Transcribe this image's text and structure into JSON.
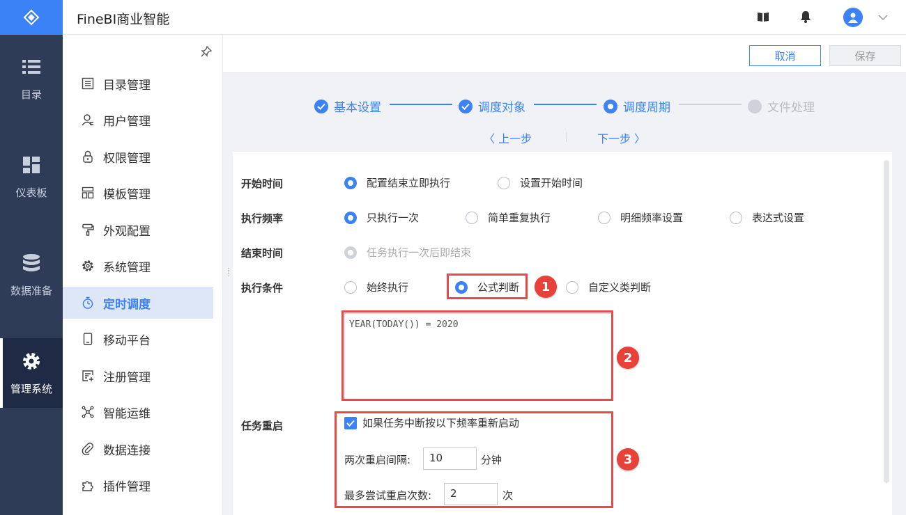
{
  "app": {
    "title": "FineBI商业智能"
  },
  "rail": [
    {
      "label": "目录",
      "icon": "list-icon"
    },
    {
      "label": "仪表板",
      "icon": "dashboard-icon"
    },
    {
      "label": "数据准备",
      "icon": "database-icon"
    },
    {
      "label": "管理系统",
      "icon": "gear-icon",
      "active": true
    }
  ],
  "menu": [
    {
      "label": "目录管理",
      "icon": "catalog-icon"
    },
    {
      "label": "用户管理",
      "icon": "user-icon"
    },
    {
      "label": "权限管理",
      "icon": "lock-icon"
    },
    {
      "label": "模板管理",
      "icon": "template-icon"
    },
    {
      "label": "外观配置",
      "icon": "paint-roller-icon"
    },
    {
      "label": "系统管理",
      "icon": "gear-icon"
    },
    {
      "label": "定时调度",
      "icon": "stopwatch-icon",
      "active": true
    },
    {
      "label": "移动平台",
      "icon": "mobile-icon"
    },
    {
      "label": "注册管理",
      "icon": "register-icon"
    },
    {
      "label": "智能运维",
      "icon": "network-icon"
    },
    {
      "label": "数据连接",
      "icon": "paperclip-icon"
    },
    {
      "label": "插件管理",
      "icon": "puzzle-icon"
    }
  ],
  "toolbar": {
    "cancel_label": "取消",
    "save_label": "保存"
  },
  "steps": [
    {
      "label": "基本设置",
      "status": "done"
    },
    {
      "label": "调度对象",
      "status": "done"
    },
    {
      "label": "调度周期",
      "status": "current"
    },
    {
      "label": "文件处理",
      "status": "pending"
    }
  ],
  "nav": {
    "prev_label": "上一步",
    "next_label": "下一步"
  },
  "form": {
    "start_time": {
      "label": "开始时间",
      "options": [
        {
          "label": "配置结束立即执行",
          "checked": true
        },
        {
          "label": "设置开始时间",
          "checked": false
        }
      ]
    },
    "frequency": {
      "label": "执行频率",
      "options": [
        {
          "label": "只执行一次",
          "checked": true
        },
        {
          "label": "简单重复执行",
          "checked": false
        },
        {
          "label": "明细频率设置",
          "checked": false
        },
        {
          "label": "表达式设置",
          "checked": false
        }
      ]
    },
    "end_time": {
      "label": "结束时间",
      "options": [
        {
          "label": "任务执行一次后即结束",
          "checked": true,
          "disabled": true
        }
      ]
    },
    "condition": {
      "label": "执行条件",
      "options": [
        {
          "label": "始终执行",
          "checked": false
        },
        {
          "label": "公式判断",
          "checked": true
        },
        {
          "label": "自定义类判断",
          "checked": false
        }
      ],
      "formula": "YEAR(TODAY()) = 2020"
    },
    "restart": {
      "label": "任务重启",
      "checkbox_label": "如果任务中断按以下频率重新启动",
      "checked": true,
      "interval_label": "两次重启间隔:",
      "interval_value": "10",
      "interval_unit": "分钟",
      "retries_label": "最多尝试重启次数:",
      "retries_value": "2",
      "retries_unit": "次"
    }
  },
  "annotations": [
    "1",
    "2",
    "3"
  ],
  "colors": {
    "accent": "#3b82f6",
    "rail": "#2e3c57",
    "highlight": "#e84a4a"
  }
}
